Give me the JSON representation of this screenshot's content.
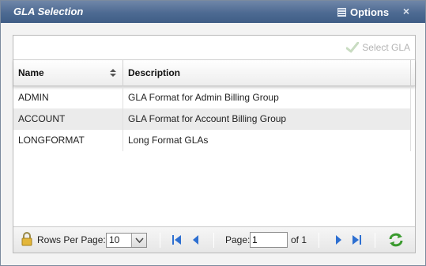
{
  "dialog": {
    "title": "GLA Selection",
    "options_label": "Options",
    "close_glyph": "×"
  },
  "toolbar": {
    "select_label": "Select GLA"
  },
  "grid": {
    "columns": [
      "Name",
      "Description"
    ],
    "rows": [
      {
        "name": "ADMIN",
        "description": "GLA Format for Admin Billing Group"
      },
      {
        "name": "ACCOUNT",
        "description": "GLA Format for Account Billing Group"
      },
      {
        "name": "LONGFORMAT",
        "description": "Long Format GLAs"
      }
    ]
  },
  "pager": {
    "rows_per_page_label": "Rows Per Page:",
    "rows_per_page_value": "10",
    "page_label": "Page:",
    "page_value": "1",
    "of_label": "of 1"
  },
  "colors": {
    "titlebar": "#4d6a92",
    "nav_blue": "#2d6fd1",
    "refresh_green": "#3a9a2e"
  }
}
